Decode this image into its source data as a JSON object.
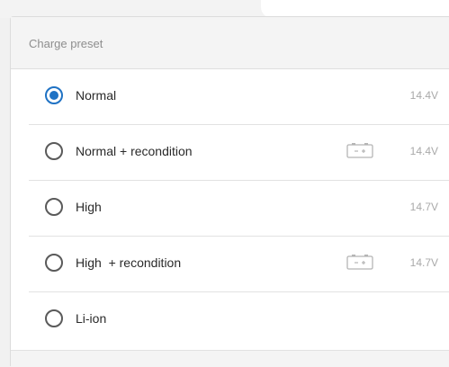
{
  "panel": {
    "title": "Charge preset"
  },
  "presets": [
    {
      "label": "Normal",
      "voltage": "14.4V",
      "selected": true,
      "recondition_icon": false
    },
    {
      "label": "Normal + recondition",
      "voltage": "14.4V",
      "selected": false,
      "recondition_icon": true
    },
    {
      "label": "High",
      "voltage": "14.7V",
      "selected": false,
      "recondition_icon": false
    },
    {
      "label": "High  + recondition",
      "voltage": "14.7V",
      "selected": false,
      "recondition_icon": true
    },
    {
      "label": "Li-ion",
      "voltage": "",
      "selected": false,
      "recondition_icon": false
    }
  ],
  "icons": {
    "recondition": "battery-recondition-icon"
  },
  "colors": {
    "accent": "#1f72c4",
    "voltage_text": "#a9a9a9"
  }
}
